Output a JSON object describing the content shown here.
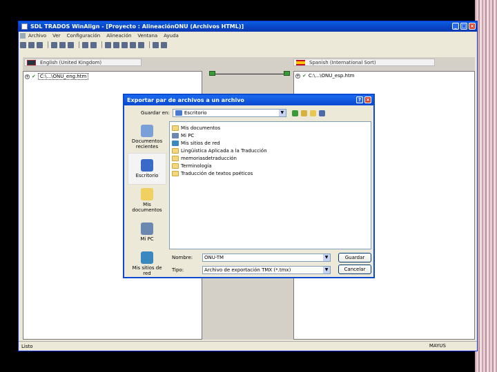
{
  "window": {
    "title": "SDL TRADOS WinAlign - [Proyecto : AlineaciónONU (Archivos HTML)]"
  },
  "menu": {
    "items": [
      "Archivo",
      "Ver",
      "Configuración",
      "Alineación",
      "Ventana",
      "Ayuda"
    ]
  },
  "panes": {
    "left_language": "English (United Kingdom)",
    "right_language": "Spanish (International Sort)",
    "left_segment": "C:\\...\\ONU_eng.htm",
    "right_segment": "C:\\...\\ONU_esp.htm"
  },
  "status": {
    "left": "Listo",
    "right": "MAYUS"
  },
  "dialog": {
    "title": "Exportar par de archivos a un archivo",
    "save_in_label": "Guardar en:",
    "save_in_value": "Escritorio",
    "places": [
      {
        "label": "Documentos recientes",
        "icon": "recent-documents-icon"
      },
      {
        "label": "Escritorio",
        "icon": "desktop-icon"
      },
      {
        "label": "Mis documentos",
        "icon": "my-documents-icon"
      },
      {
        "label": "Mi PC",
        "icon": "my-computer-icon"
      },
      {
        "label": "Mis sitios de red",
        "icon": "network-places-icon"
      }
    ],
    "files": [
      {
        "name": "Mis documentos",
        "icon": "my-documents-icon"
      },
      {
        "name": "Mi PC",
        "icon": "my-computer-icon"
      },
      {
        "name": "Mis sitios de red",
        "icon": "network-places-icon"
      },
      {
        "name": "Lingüística Aplicada a la Traducción",
        "icon": "folder-icon"
      },
      {
        "name": "memoriasdetraducción",
        "icon": "folder-icon"
      },
      {
        "name": "Terminología",
        "icon": "folder-icon"
      },
      {
        "name": "Traducción de textos poéticos",
        "icon": "folder-icon"
      }
    ],
    "filename_label": "Nombre:",
    "filename_value": "ONU-TM",
    "filetype_label": "Tipo:",
    "filetype_value": "Archivo de exportación TMX (*.tmx)",
    "save_button": "Guardar",
    "cancel_button": "Cancelar"
  },
  "colors": {
    "titlebar": "#0842c4",
    "accent_green": "#2a8a2a",
    "folder": "#f4d77a"
  }
}
